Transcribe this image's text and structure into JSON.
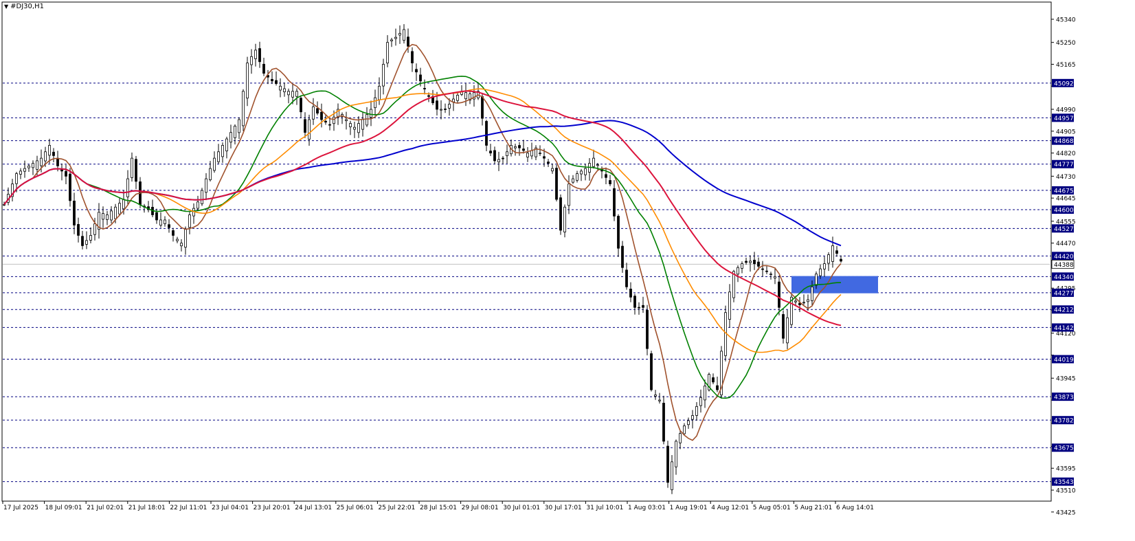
{
  "symbol_title": "#DJ30,H1",
  "colors": {
    "background": "#ffffff",
    "grid_line": "#000080",
    "candle": "#000000",
    "ma_fast": "#a0522d",
    "ma_green": "#008000",
    "ma_orange": "#ff8c00",
    "ma_blue": "#0000cd",
    "ma_red": "#dc143c",
    "level_badge_bg": "#000080",
    "level_badge_text": "#ffffff",
    "current_badge_bg": "#ffffff",
    "zone": "#4169e1"
  },
  "chart_data": {
    "type": "candlestick",
    "title": "#DJ30,H1",
    "ylim": [
      43425,
      45385
    ],
    "y_ticks": [
      45340,
      45250,
      45165,
      45080,
      44990,
      44905,
      44820,
      44730,
      44645,
      44555,
      44470,
      44385,
      44295,
      44210,
      44120,
      44035,
      43945,
      43860,
      43770,
      43680,
      43595,
      43510,
      43425
    ],
    "x_ticks": [
      "17 Jul 2025",
      "18 Jul 09:01",
      "21 Jul 02:01",
      "21 Jul 18:01",
      "22 Jul 11:01",
      "23 Jul 04:01",
      "23 Jul 20:01",
      "24 Jul 13:01",
      "25 Jul 06:01",
      "25 Jul 22:01",
      "28 Jul 15:01",
      "29 Jul 08:01",
      "30 Jul 01:01",
      "30 Jul 17:01",
      "31 Jul 10:01",
      "1 Aug 03:01",
      "1 Aug 19:01",
      "4 Aug 12:01",
      "5 Aug 05:01",
      "5 Aug 21:01",
      "6 Aug 14:01"
    ],
    "horizontal_levels": [
      45092,
      44957,
      44868,
      44777,
      44675,
      44600,
      44527,
      44420,
      44340,
      44277,
      44212,
      44142,
      44019,
      43873,
      43782,
      43675,
      43543
    ],
    "current_price": 44388,
    "zone": {
      "from_bar": 191,
      "to_bar": 212,
      "low": 44275,
      "high": 44342
    },
    "anchors": [
      [
        0,
        44620
      ],
      [
        3,
        44740
      ],
      [
        6,
        44770
      ],
      [
        9,
        44800
      ],
      [
        11,
        44850
      ],
      [
        13,
        44770
      ],
      [
        15,
        44730
      ],
      [
        17,
        44540
      ],
      [
        19,
        44460
      ],
      [
        21,
        44500
      ],
      [
        23,
        44590
      ],
      [
        25,
        44580
      ],
      [
        27,
        44610
      ],
      [
        29,
        44640
      ],
      [
        31,
        44800
      ],
      [
        33,
        44620
      ],
      [
        35,
        44600
      ],
      [
        37,
        44560
      ],
      [
        39,
        44560
      ],
      [
        41,
        44500
      ],
      [
        43,
        44470
      ],
      [
        45,
        44580
      ],
      [
        47,
        44630
      ],
      [
        49,
        44720
      ],
      [
        51,
        44800
      ],
      [
        53,
        44850
      ],
      [
        55,
        44900
      ],
      [
        57,
        44950
      ],
      [
        59,
        45170
      ],
      [
        61,
        45220
      ],
      [
        63,
        45130
      ],
      [
        65,
        45100
      ],
      [
        67,
        45080
      ],
      [
        69,
        45060
      ],
      [
        71,
        45060
      ],
      [
        73,
        44900
      ],
      [
        75,
        45000
      ],
      [
        77,
        44950
      ],
      [
        79,
        44930
      ],
      [
        81,
        44990
      ],
      [
        83,
        44950
      ],
      [
        85,
        44920
      ],
      [
        87,
        44950
      ],
      [
        89,
        44990
      ],
      [
        91,
        45080
      ],
      [
        93,
        45250
      ],
      [
        95,
        45270
      ],
      [
        97,
        45300
      ],
      [
        99,
        45170
      ],
      [
        101,
        45100
      ],
      [
        103,
        45040
      ],
      [
        105,
        44990
      ],
      [
        107,
        44990
      ],
      [
        109,
        45030
      ],
      [
        111,
        45060
      ],
      [
        113,
        45050
      ],
      [
        115,
        45060
      ],
      [
        117,
        44850
      ],
      [
        119,
        44790
      ],
      [
        121,
        44800
      ],
      [
        123,
        44850
      ],
      [
        125,
        44840
      ],
      [
        127,
        44820
      ],
      [
        129,
        44840
      ],
      [
        131,
        44800
      ],
      [
        133,
        44760
      ],
      [
        135,
        44520
      ],
      [
        137,
        44700
      ],
      [
        139,
        44740
      ],
      [
        141,
        44760
      ],
      [
        143,
        44800
      ],
      [
        145,
        44750
      ],
      [
        147,
        44700
      ],
      [
        149,
        44450
      ],
      [
        151,
        44300
      ],
      [
        153,
        44220
      ],
      [
        155,
        44220
      ],
      [
        157,
        43900
      ],
      [
        159,
        43860
      ],
      [
        161,
        43540
      ],
      [
        163,
        43700
      ],
      [
        165,
        43760
      ],
      [
        167,
        43800
      ],
      [
        169,
        43870
      ],
      [
        171,
        43960
      ],
      [
        173,
        43900
      ],
      [
        175,
        44200
      ],
      [
        177,
        44360
      ],
      [
        179,
        44390
      ],
      [
        181,
        44400
      ],
      [
        183,
        44380
      ],
      [
        185,
        44360
      ],
      [
        187,
        44340
      ],
      [
        189,
        44100
      ],
      [
        191,
        44260
      ],
      [
        193,
        44230
      ],
      [
        195,
        44250
      ],
      [
        197,
        44350
      ],
      [
        199,
        44390
      ],
      [
        201,
        44460
      ],
      [
        203,
        44400
      ]
    ],
    "series": [
      {
        "name": "",
        "color": "#a0522d",
        "period": 8
      },
      {
        "name": "",
        "color": "#008000",
        "period": 21
      },
      {
        "name": "",
        "color": "#ff8c00",
        "period": 34
      },
      {
        "name": "",
        "color": "#0000cd",
        "period": 100
      },
      {
        "name": "",
        "color": "#dc143c",
        "period": 55
      }
    ]
  }
}
